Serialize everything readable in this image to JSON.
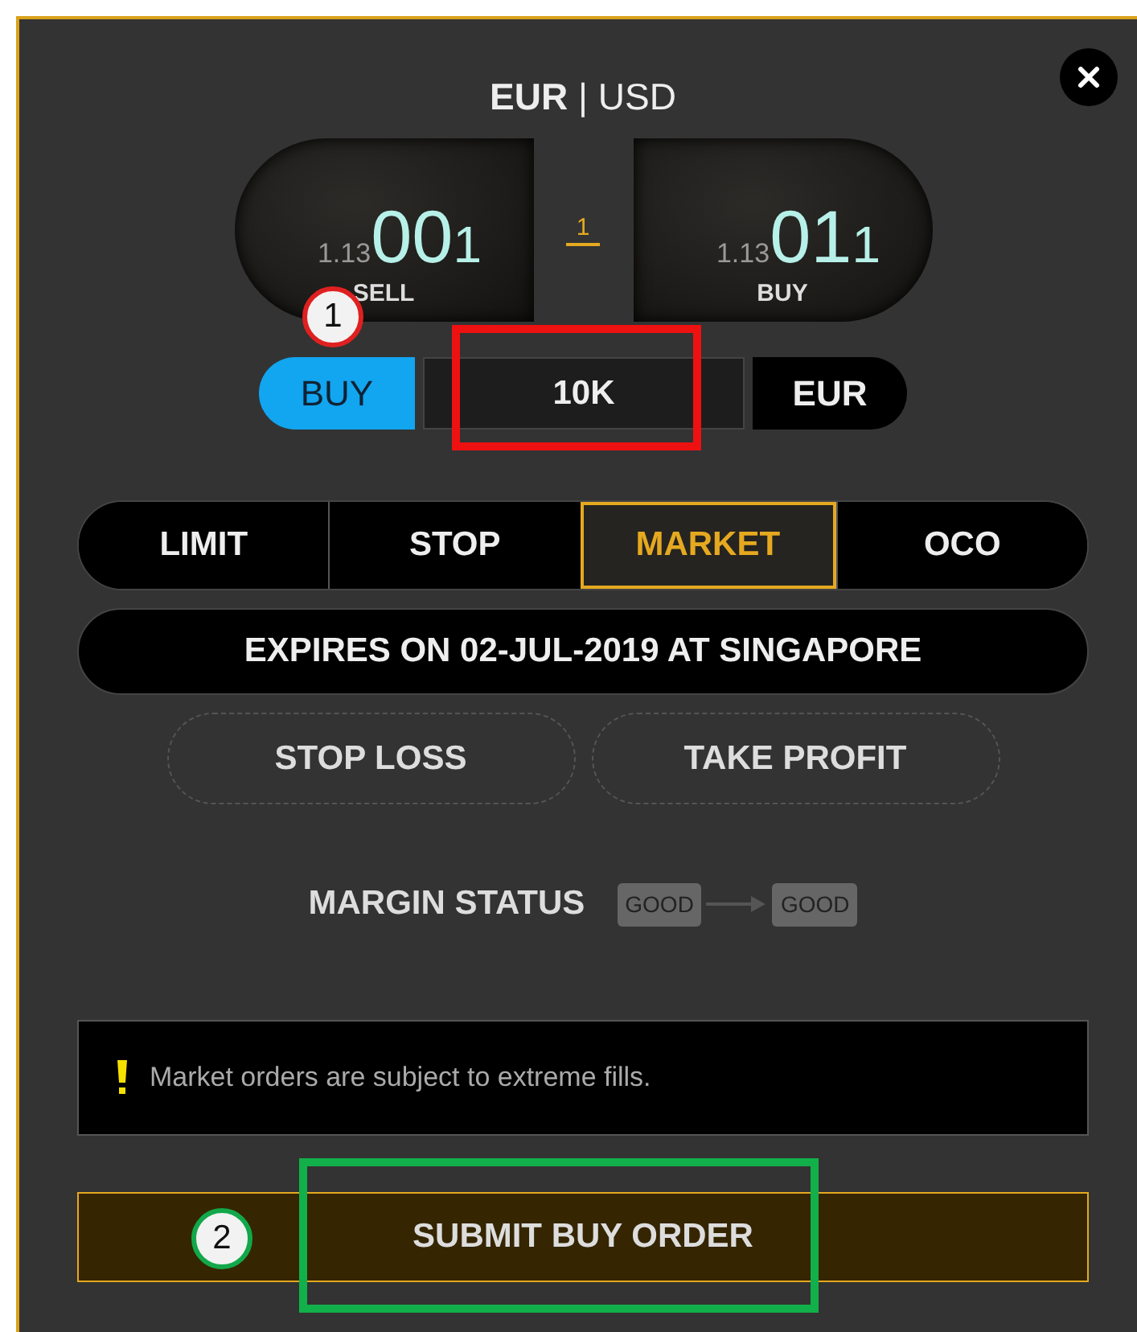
{
  "title": "**EUR** | USD",
  "quotes": [
    {
      "kind": "sell",
      "prefix": "1.13",
      "big": "00",
      "pip": "1",
      "label": "SELL"
    },
    {
      "kind": "buy",
      "prefix": "1.13",
      "big": "01",
      "pip": "1",
      "label": "BUY"
    }
  ],
  "spread": "1",
  "trade": {
    "side": "BUY",
    "amount": "10K",
    "currency": "EUR"
  },
  "order_types": [
    {
      "label": "LIMIT",
      "selected": false
    },
    {
      "label": "STOP",
      "selected": false
    },
    {
      "label": "MARKET",
      "selected": true
    },
    {
      "label": "OCO",
      "selected": false
    }
  ],
  "expiry": "EXPIRES ON 02-JUL-2019 AT SINGAPORE",
  "extras": [
    "STOP LOSS",
    "TAKE PROFIT"
  ],
  "margin": {
    "label": "MARGIN STATUS",
    "from": "GOOD",
    "to": "GOOD"
  },
  "warning": "Market orders are subject to extreme fills.",
  "submit": "SUBMIT BUY ORDER",
  "annotations": [
    {
      "label": "1",
      "color": "#e02020"
    },
    {
      "label": "2",
      "color": "#12a84a"
    }
  ],
  "highlights": [
    {
      "color": "#ee1111"
    },
    {
      "color": "#12b04a"
    }
  ]
}
